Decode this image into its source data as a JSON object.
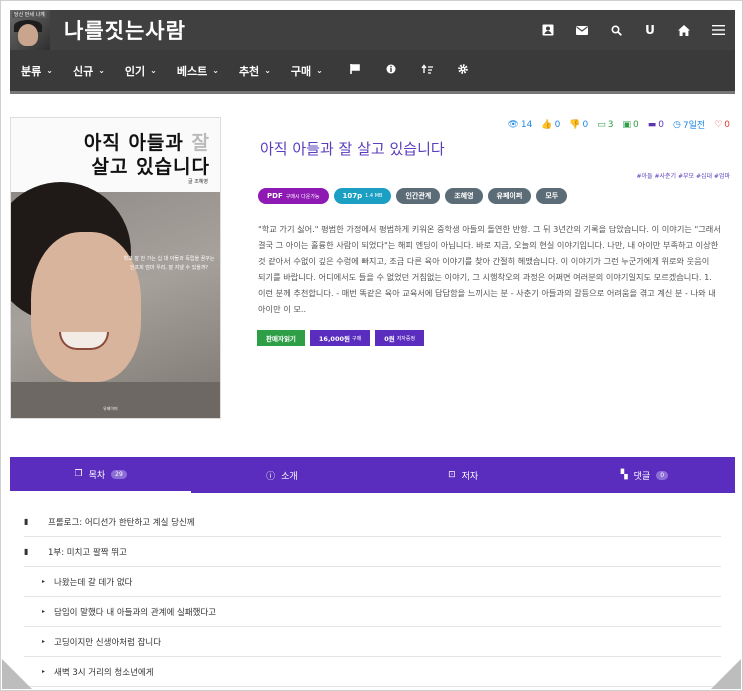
{
  "header": {
    "site_title": "나를짓는사람",
    "logo_tag": "당신 만세 나게",
    "icons": [
      "profile-icon",
      "mail-icon",
      "search-icon",
      "user-icon",
      "home-icon",
      "menu-icon"
    ],
    "user_letter": "U"
  },
  "nav": {
    "items": [
      {
        "label": "분류"
      },
      {
        "label": "신규"
      },
      {
        "label": "인기"
      },
      {
        "label": "베스트"
      },
      {
        "label": "추천"
      },
      {
        "label": "구매"
      }
    ],
    "icons": [
      "flag-icon",
      "info-icon",
      "sort-icon",
      "gear-icon"
    ]
  },
  "book": {
    "cover": {
      "title_line1": "아직 아들과",
      "title_line1_light": "잘",
      "title_line2": "살고 있습니다",
      "author": "글 조혜영",
      "blurb": "학교 잘 안 가는 십 대 아들과 독립을 꿈꾸는 인프피 엄마 우리, 잘 지낼 수 있을까?",
      "publisher": "유페이퍼"
    },
    "stats": {
      "views": "14",
      "likes": "0",
      "dislikes": "0",
      "comments": "3",
      "reviews": "0",
      "messages": "0",
      "date": "7일전",
      "hearts": "0"
    },
    "title": "아직 아들과 잘 살고 있습니다",
    "hashtags": "#아들 #사춘기 #부모 #십대 #엄마",
    "badges": {
      "pdf": "PDF",
      "pdf_note": "구매시 다운가능",
      "pages": "107p",
      "size": "1.4 MB",
      "category": "인간관계",
      "author": "조혜영",
      "publisher": "유페이퍼",
      "audience": "모두"
    },
    "description": "\"학교 가기 싫어.\" 평범한 가정에서 평범하게 키워온 중학생 아들의 돌연한 반항. 그 뒤 3년간의 기록을 담았습니다. 이 이야기는 \"그래서 결국 그 아이는 훌륭한 사람이 되었다\"는 해피 엔딩이 아닙니다. 바로 지금, 오늘의 현실 이야기입니다. 나만, 내 아이만 부족하고 이상한 것 같아서 수없이 깊은 수렁에 빠지고, 조금 다른 육아 이야기를 찾아 간절히 헤맸습니다. 이 이야기가 그런 누군가에게 위로와 웃음이 되기를 바랍니다. 어디에서도 들을 수 없었던 거침없는 이야기, 그 시행착오의 과정은 어쩌면 여러분의 이야기일지도 모르겠습니다. 1. 이런 분께 추천합니다. - 매번 똑같은 육아 교육서에 답답함을 느끼시는 분 - 사춘기 아들과의 갈등으로 어려움을 겪고 계신 분 - 나와 내 아이만 이 모..",
    "actions": {
      "preview": "판매자읽기",
      "price": "16,000원",
      "price_suffix": "구매",
      "gift": "0원",
      "gift_suffix": "저자증정"
    }
  },
  "tabs": [
    {
      "label": "목차",
      "count": "29"
    },
    {
      "label": "소개"
    },
    {
      "label": "저자"
    },
    {
      "label": "댓글",
      "count": "0"
    }
  ],
  "toc": [
    {
      "label": "프롤로그: 어디선가 한탄하고 계실 당신께",
      "level": 1
    },
    {
      "label": "1부: 미치고 팔짝 뛰고",
      "level": 1
    },
    {
      "label": "나왔는데 갈 데가 없다",
      "level": 2
    },
    {
      "label": "담임이 말했다 내 아들과의 관계에 실패했다고",
      "level": 2
    },
    {
      "label": "고딩이지만 신생아처럼 잡니다",
      "level": 2
    },
    {
      "label": "새벽 3시 거리의 청소년에게",
      "level": 2
    }
  ]
}
